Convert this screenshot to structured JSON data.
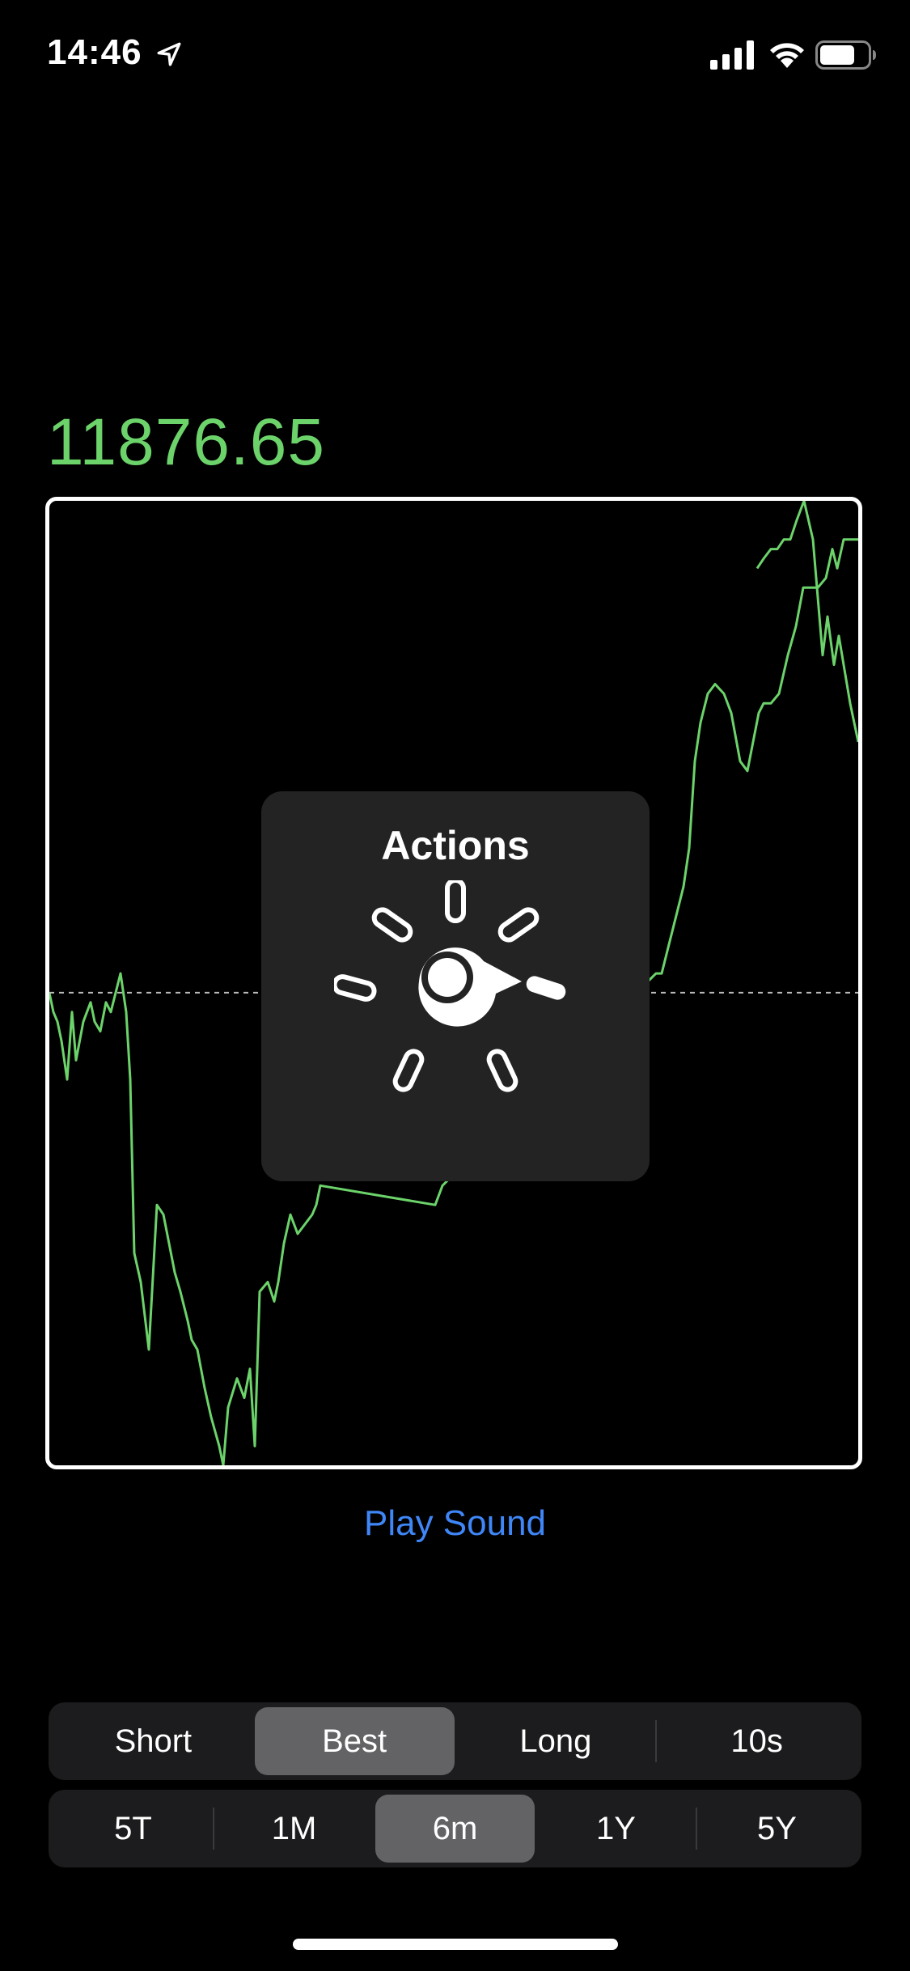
{
  "status_bar": {
    "time": "14:46",
    "icons": [
      "location-arrow-icon",
      "cellular-signal-icon",
      "wifi-icon",
      "battery-icon"
    ]
  },
  "price": {
    "value": "11876.65",
    "color": "#6cd36b"
  },
  "chart_data": {
    "type": "line",
    "series_color": "#6cd36b",
    "baseline": 0.49,
    "ylim": [
      0,
      1
    ],
    "points": [
      [
        0,
        0.49
      ],
      [
        0.5,
        0.47
      ],
      [
        1,
        0.46
      ],
      [
        1.5,
        0.44
      ],
      [
        2.2,
        0.4
      ],
      [
        2.8,
        0.47
      ],
      [
        3.3,
        0.42
      ],
      [
        4.2,
        0.46
      ],
      [
        5.1,
        0.48
      ],
      [
        5.6,
        0.46
      ],
      [
        6.3,
        0.45
      ],
      [
        7.0,
        0.48
      ],
      [
        7.6,
        0.47
      ],
      [
        8.2,
        0.49
      ],
      [
        8.8,
        0.51
      ],
      [
        9.5,
        0.47
      ],
      [
        10.0,
        0.4
      ],
      [
        10.5,
        0.22
      ],
      [
        11.3,
        0.19
      ],
      [
        12.3,
        0.12
      ],
      [
        13.3,
        0.27
      ],
      [
        14.1,
        0.26
      ],
      [
        14.8,
        0.23
      ],
      [
        15.5,
        0.2
      ],
      [
        16.2,
        0.18
      ],
      [
        17.1,
        0.15
      ],
      [
        17.6,
        0.13
      ],
      [
        18.3,
        0.12
      ],
      [
        19.2,
        0.08
      ],
      [
        20.0,
        0.05
      ],
      [
        21.0,
        0.02
      ],
      [
        21.5,
        0.0
      ],
      [
        22.1,
        0.06
      ],
      [
        23.2,
        0.09
      ],
      [
        24.1,
        0.07
      ],
      [
        24.8,
        0.1
      ],
      [
        25.4,
        0.02
      ],
      [
        26.0,
        0.18
      ],
      [
        27.0,
        0.19
      ],
      [
        27.8,
        0.17
      ],
      [
        28.3,
        0.19
      ],
      [
        29.0,
        0.23
      ],
      [
        29.8,
        0.26
      ],
      [
        30.7,
        0.24
      ],
      [
        31.6,
        0.25
      ],
      [
        32.5,
        0.26
      ],
      [
        33.0,
        0.27
      ],
      [
        33.5,
        0.29
      ],
      [
        47.7,
        0.27
      ],
      [
        48.6,
        0.29
      ],
      [
        75.0,
        0.51
      ],
      [
        75.7,
        0.51
      ],
      [
        76.6,
        0.54
      ],
      [
        77.5,
        0.57
      ],
      [
        78.4,
        0.6
      ],
      [
        79.1,
        0.64
      ],
      [
        79.8,
        0.73
      ],
      [
        80.5,
        0.77
      ],
      [
        81.4,
        0.8
      ],
      [
        82.3,
        0.81
      ],
      [
        83.4,
        0.8
      ],
      [
        84.3,
        0.78
      ],
      [
        85.4,
        0.73
      ],
      [
        86.3,
        0.72
      ],
      [
        87.0,
        0.75
      ],
      [
        87.7,
        0.78
      ],
      [
        88.3,
        0.79
      ],
      [
        89.2,
        0.79
      ],
      [
        90.2,
        0.8
      ],
      [
        91.3,
        0.84
      ],
      [
        92.3,
        0.87
      ],
      [
        93.2,
        0.91
      ],
      [
        94.1,
        0.91
      ],
      [
        95.0,
        0.91
      ],
      [
        96.0,
        0.92
      ],
      [
        96.8,
        0.95
      ],
      [
        97.4,
        0.93
      ],
      [
        98.2,
        0.96
      ],
      [
        99.0,
        0.96
      ],
      [
        100.0,
        0.96
      ]
    ],
    "right_segment": [
      [
        87.5,
        0.93
      ],
      [
        88.3,
        0.94
      ],
      [
        89.2,
        0.95
      ],
      [
        90.0,
        0.95
      ],
      [
        90.8,
        0.96
      ],
      [
        91.6,
        0.96
      ],
      [
        92.4,
        0.98
      ],
      [
        93.3,
        1.0
      ],
      [
        94.4,
        0.96
      ],
      [
        95.0,
        0.9
      ],
      [
        95.6,
        0.84
      ],
      [
        96.2,
        0.88
      ],
      [
        97.0,
        0.83
      ],
      [
        97.6,
        0.86
      ],
      [
        98.4,
        0.82
      ],
      [
        99.0,
        0.79
      ],
      [
        100.0,
        0.75
      ]
    ]
  },
  "actions_hud": {
    "title": "Actions"
  },
  "play_sound": {
    "label": "Play Sound",
    "color": "#3f86f7"
  },
  "segment_top": {
    "items": [
      "Short",
      "Best",
      "Long",
      "10s"
    ],
    "selected": "Best"
  },
  "segment_bottom": {
    "items": [
      "5T",
      "1M",
      "6m",
      "1Y",
      "5Y"
    ],
    "selected": "6m"
  }
}
